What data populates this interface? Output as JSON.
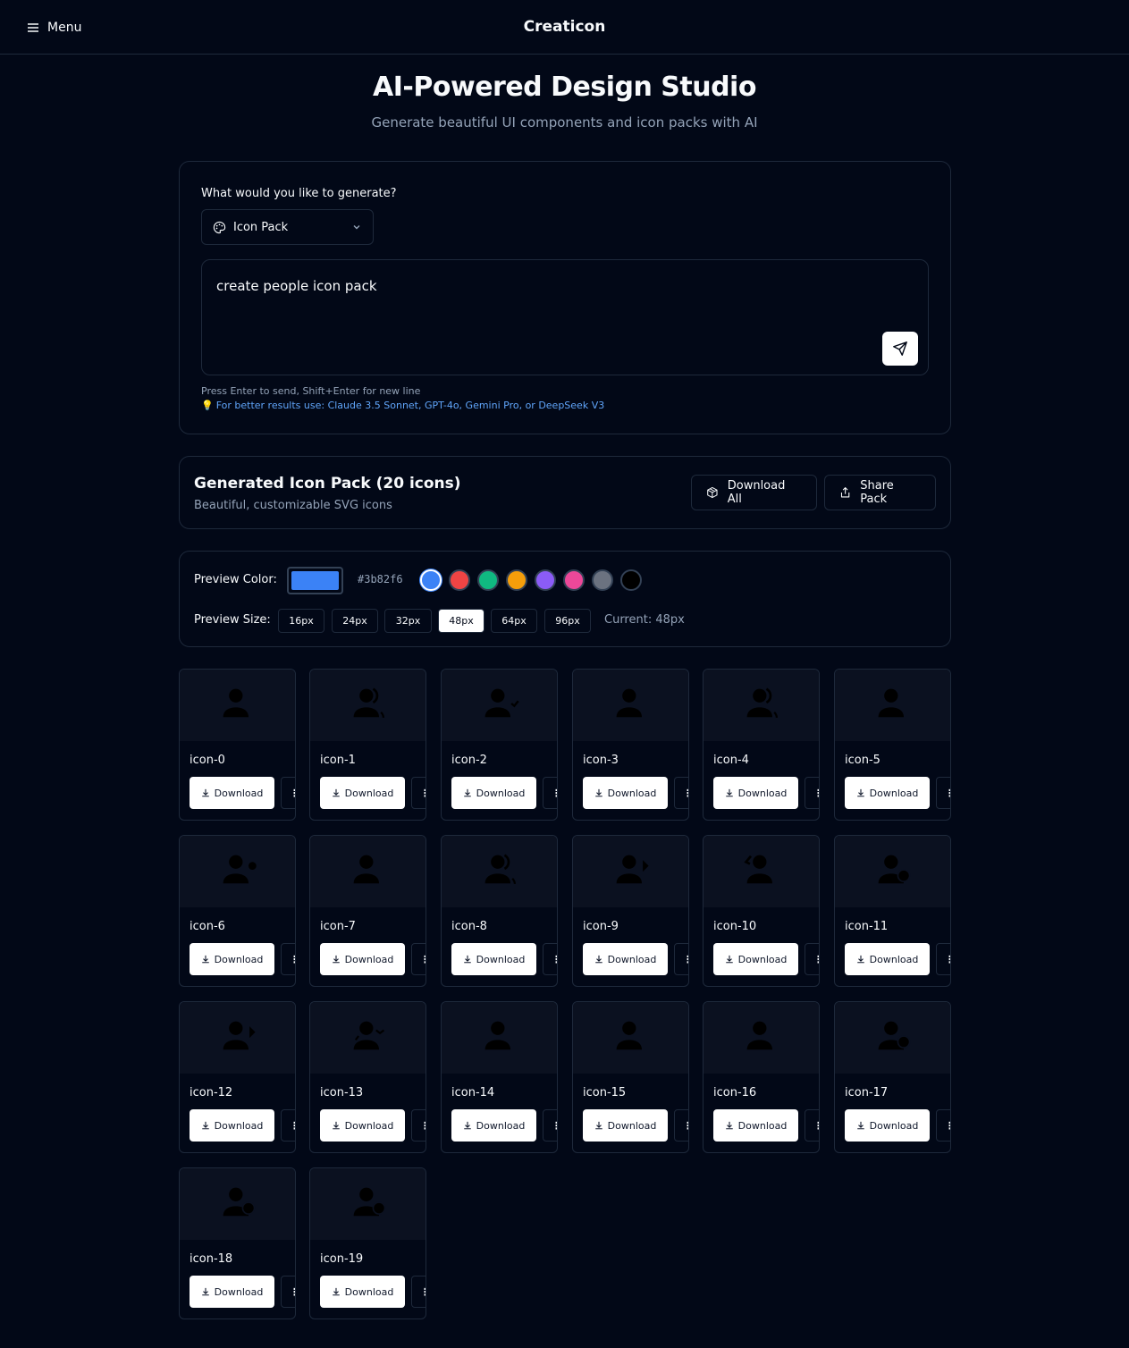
{
  "header": {
    "menu_label": "Menu",
    "brand": "Creaticon"
  },
  "hero": {
    "title": "AI-Powered Design Studio",
    "subtitle": "Generate beautiful UI components and icon packs with AI"
  },
  "generator": {
    "question": "What would you like to generate?",
    "type_selected": "Icon Pack",
    "prompt_value": "create people icon pack",
    "hint": "Press Enter to send, Shift+Enter for new line",
    "tip": "For better results use: Claude 3.5 Sonnet, GPT-4o, Gemini Pro, or DeepSeek V3"
  },
  "pack": {
    "title": "Generated Icon Pack (20 icons)",
    "subtitle": "Beautiful, customizable SVG icons",
    "download_all": "Download All",
    "share": "Share Pack"
  },
  "preview": {
    "color_label": "Preview Color:",
    "color_hex": "#3b82f6",
    "swatches": [
      "#3b82f6",
      "#ef4444",
      "#10b981",
      "#f59e0b",
      "#8b5cf6",
      "#ec4899",
      "#6b7280",
      "#000000"
    ],
    "size_label": "Preview Size:",
    "sizes": [
      "16px",
      "24px",
      "32px",
      "48px",
      "64px",
      "96px"
    ],
    "selected_size": "48px",
    "current": "Current: 48px"
  },
  "icons": [
    {
      "name": "icon-0",
      "variant": "person"
    },
    {
      "name": "icon-1",
      "variant": "person-arc"
    },
    {
      "name": "icon-2",
      "variant": "person-check"
    },
    {
      "name": "icon-3",
      "variant": "person"
    },
    {
      "name": "icon-4",
      "variant": "person-arc"
    },
    {
      "name": "icon-5",
      "variant": "person"
    },
    {
      "name": "icon-6",
      "variant": "person-dot"
    },
    {
      "name": "icon-7",
      "variant": "person"
    },
    {
      "name": "icon-8",
      "variant": "person-arc"
    },
    {
      "name": "icon-9",
      "variant": "person-tri"
    },
    {
      "name": "icon-10",
      "variant": "person-back"
    },
    {
      "name": "icon-11",
      "variant": "person-badge"
    },
    {
      "name": "icon-12",
      "variant": "person-tri"
    },
    {
      "name": "icon-13",
      "variant": "person-x"
    },
    {
      "name": "icon-14",
      "variant": "person"
    },
    {
      "name": "icon-15",
      "variant": "person"
    },
    {
      "name": "icon-16",
      "variant": "person"
    },
    {
      "name": "icon-17",
      "variant": "person-badge"
    },
    {
      "name": "icon-18",
      "variant": "person-badge"
    },
    {
      "name": "icon-19",
      "variant": "person-badge"
    }
  ],
  "tile": {
    "download_label": "Download",
    "more_label": "⋮"
  }
}
